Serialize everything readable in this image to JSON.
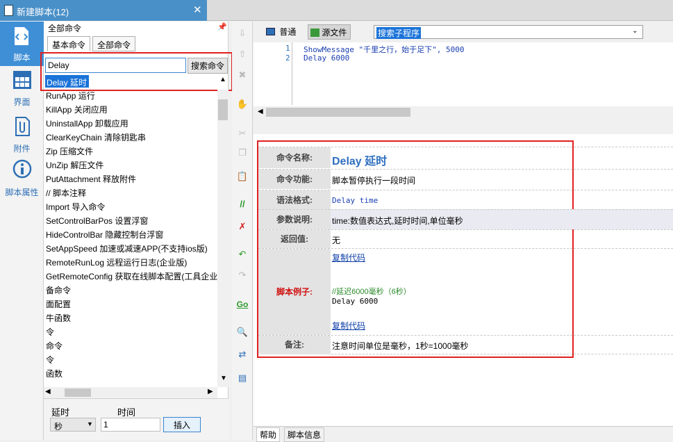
{
  "window": {
    "tab_title": "新建脚本(12)"
  },
  "rail": [
    {
      "label": "脚本",
      "icon": "script-icon"
    },
    {
      "label": "界面",
      "icon": "grid-icon"
    },
    {
      "label": "附件",
      "icon": "attachment-icon"
    },
    {
      "label": "脚本属性",
      "icon": "info-icon"
    }
  ],
  "command_panel": {
    "title": "全部命令",
    "tabs": [
      "基本命令",
      "全部命令"
    ],
    "search_value": "Delay",
    "search_button": "搜索命令",
    "search_result": "Delay 延时",
    "commands": [
      "RunApp 运行",
      "KillApp 关闭应用",
      "UninstallApp 卸载应用",
      "ClearKeyChain 清除钥匙串",
      "Zip 压缩文件",
      "UnZip 解压文件",
      "PutAttachment 释放附件",
      "// 脚本注释",
      "Import 导入命令",
      "SetControlBarPos 设置浮窗",
      "HideControlBar 隐藏控制台浮窗",
      "SetAppSpeed 加速或减速APP(不支持ios版)",
      "RemoteRunLog 远程运行日志(企业版)",
      "GetRemoteConfig 获取在线脚本配置(工具企业版)",
      "备命令",
      "面配置",
      "牛函数",
      "令",
      "命令",
      "令",
      "函数"
    ],
    "param_labels": [
      "延时",
      "时间"
    ],
    "unit_value": "秒",
    "time_value": "1",
    "insert_button": "插入"
  },
  "editor": {
    "view_tabs": [
      "普通",
      "源文件"
    ],
    "dropdown_value": "搜索子程序",
    "line_numbers": [
      "1",
      "2"
    ],
    "lines": [
      "ShowMessage \"千里之行，始于足下\", 5000",
      "Delay 6000"
    ]
  },
  "help": {
    "labels": {
      "name": "命令名称:",
      "function": "命令功能:",
      "syntax": "语法格式:",
      "params": "参数说明:",
      "return": "返回值:",
      "example": "脚本例子:",
      "note": "备注:"
    },
    "name": "Delay 延时",
    "function": "脚本暂停执行一段时间",
    "syntax": "Delay time",
    "params": "time:数值表达式,延时时间,单位毫秒",
    "return": "无",
    "copy_link": "复制代码",
    "example_comment": "//延迟6000毫秒（6秒）",
    "example_code": "Delay 6000",
    "note": "注意时间单位是毫秒，1秒=1000毫秒"
  },
  "bottom_tabs": [
    "帮助",
    "脚本信息"
  ],
  "colors": {
    "accent": "#3f8fd6",
    "highlight_border": "#e02020",
    "link": "#0b3da8",
    "keyword": "#1a3fb0",
    "name_title": "#2f6fc0",
    "example_label": "#d01010"
  }
}
